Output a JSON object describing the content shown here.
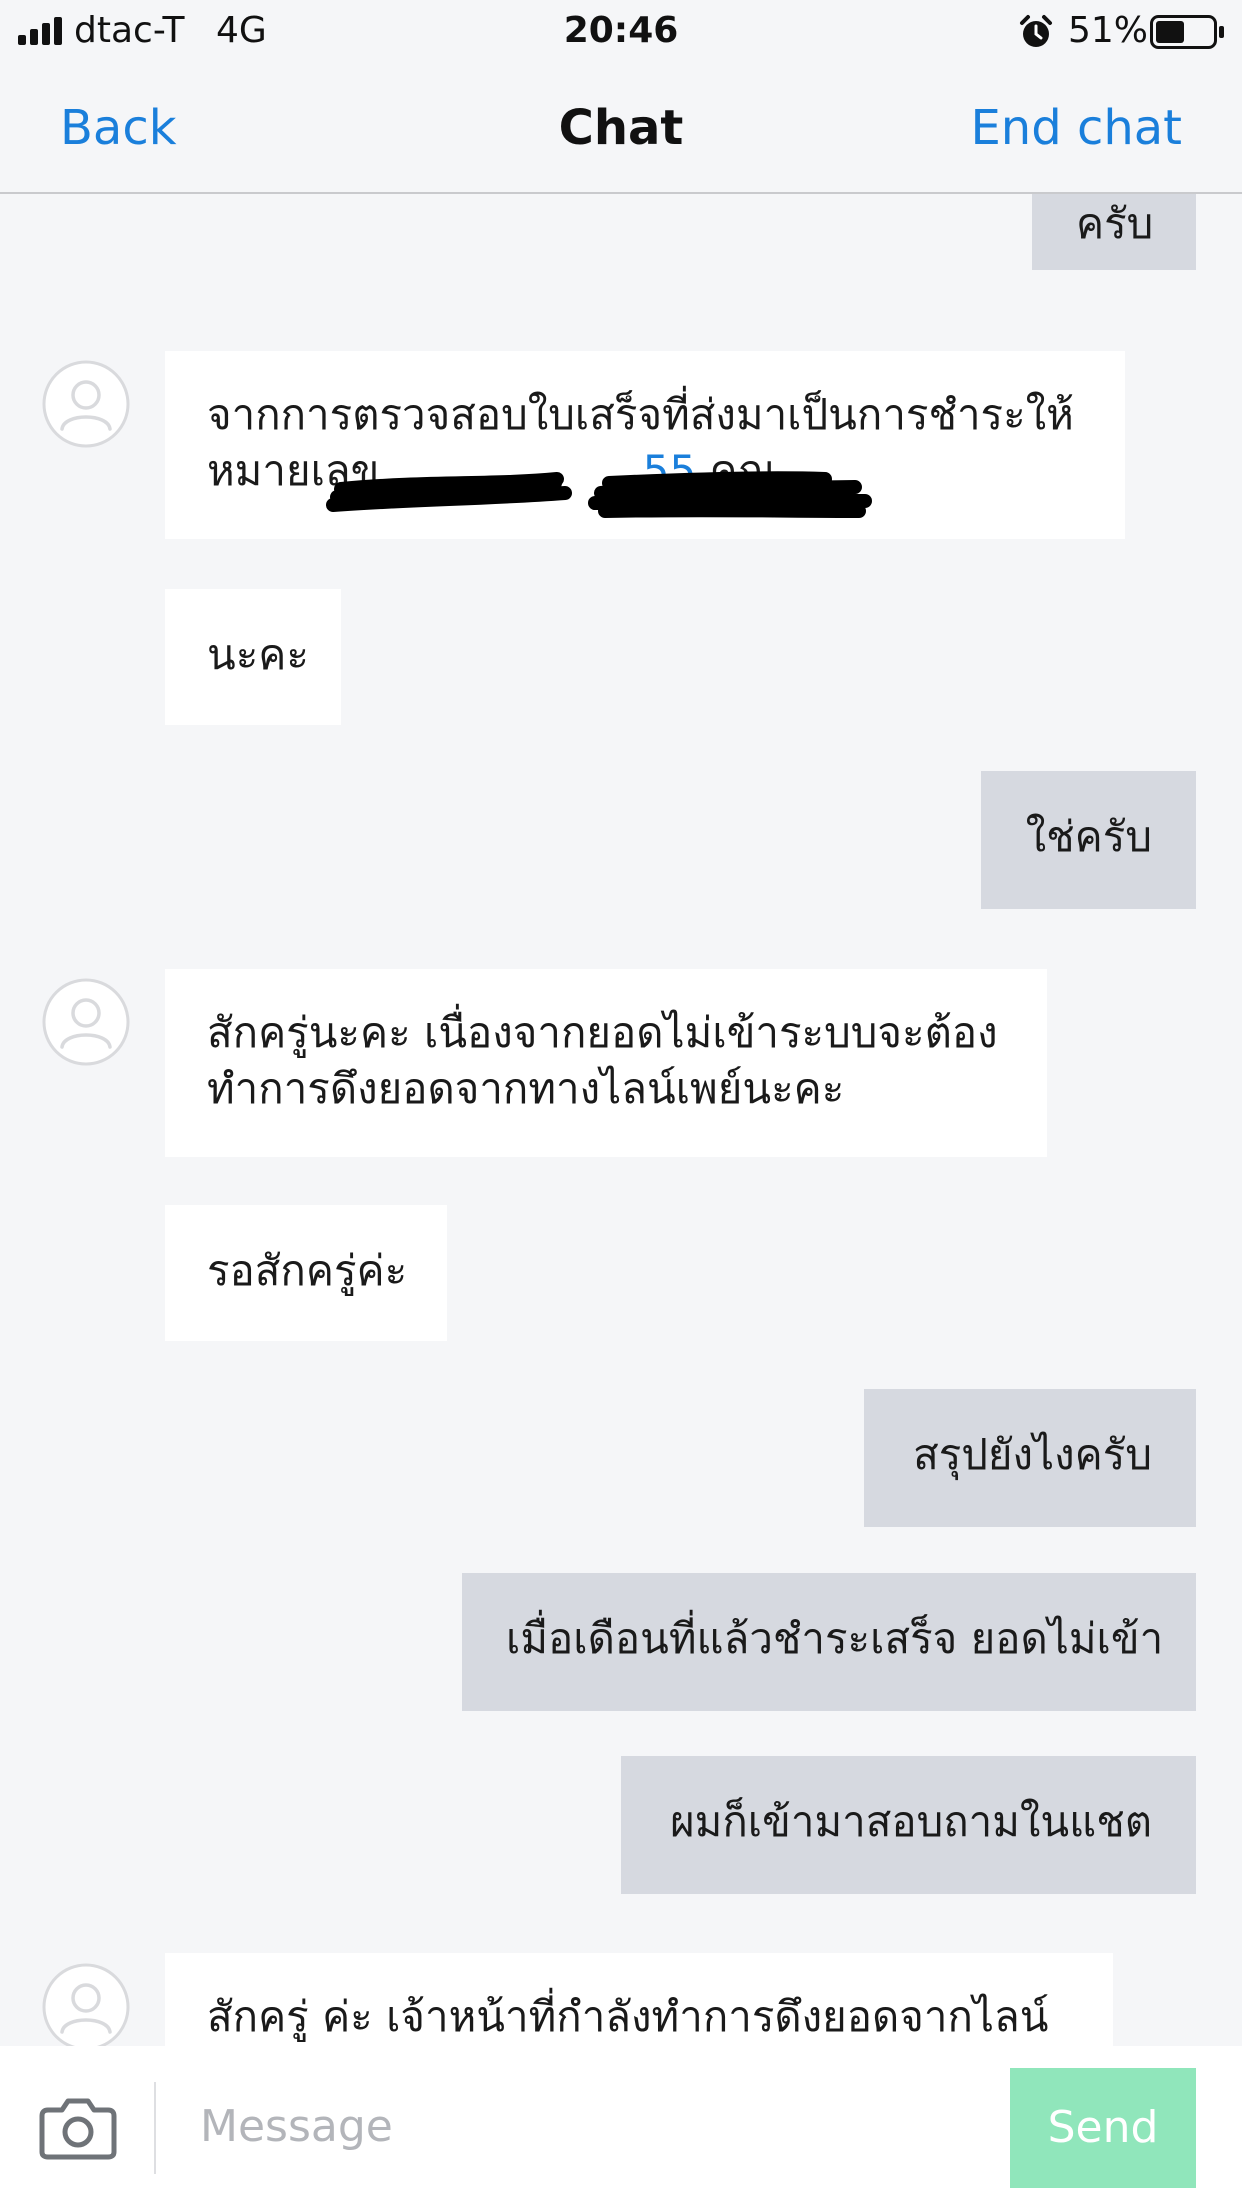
{
  "status_bar": {
    "carrier": "dtac-T",
    "network": "4G",
    "time": "20:46",
    "battery_percent": "51%",
    "battery_level": 0.51,
    "icons": [
      "signal-icon",
      "alarm-icon",
      "battery-icon"
    ]
  },
  "nav": {
    "back_label": "Back",
    "title": "Chat",
    "end_label": "End chat"
  },
  "messages": [
    {
      "sender": "user",
      "lines": [
        "ครับ"
      ]
    },
    {
      "sender": "agent",
      "lines": [
        "จากการตรวจสอบใบเสร็จที่ส่งมาเป็นการชำระให้",
        "หมายเลข ",
        "55",
        " คุณ"
      ]
    },
    {
      "sender": "agent",
      "lines": [
        "นะคะ"
      ]
    },
    {
      "sender": "user",
      "lines": [
        "ใช่ครับ"
      ]
    },
    {
      "sender": "agent",
      "lines": [
        "สักครู่นะคะ  เนื่องจากยอดไม่เข้าระบบจะต้อง",
        "ทำการดึงยอดจากทางไลน์เพย์นะคะ"
      ]
    },
    {
      "sender": "agent",
      "lines": [
        "รอสักครู่ค่ะ"
      ]
    },
    {
      "sender": "user",
      "lines": [
        "สรุปยังไงครับ"
      ]
    },
    {
      "sender": "user",
      "lines": [
        "เมื่อเดือนที่แล้วชำระเสร็จ ยอดไม่เข้า"
      ]
    },
    {
      "sender": "user",
      "lines": [
        "ผมก็เข้ามาสอบถามในแชต"
      ]
    },
    {
      "sender": "agent",
      "lines": [
        "สักครู่ ค่ะ  เจ้าหน้าที่กำลังทำการดึงยอดจากไลน์"
      ]
    }
  ],
  "input": {
    "placeholder": "Message",
    "send_label": "Send"
  },
  "colors": {
    "accent": "#1a7fdb",
    "background": "#f5f6f8",
    "agent_bubble": "#ffffff",
    "user_bubble": "#d6d9e0",
    "send_button": "#90e6bb"
  }
}
